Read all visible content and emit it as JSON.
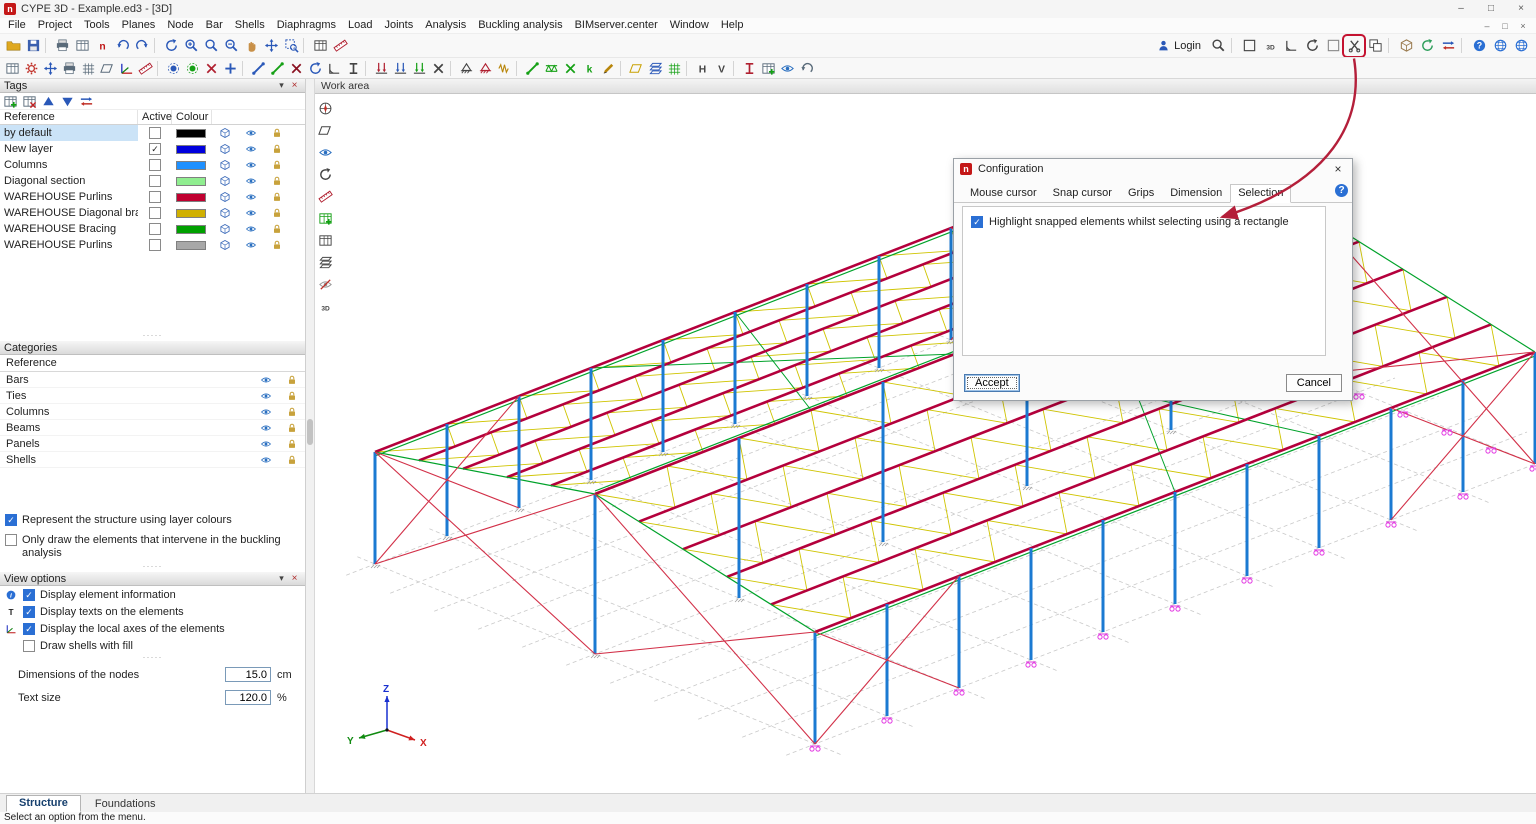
{
  "window": {
    "title": "CYPE 3D - Example.ed3 - [3D]"
  },
  "menu": {
    "items": [
      "File",
      "Project",
      "Tools",
      "Planes",
      "Node",
      "Bar",
      "Shells",
      "Diaphragms",
      "Load",
      "Joints",
      "Analysis",
      "Buckling analysis",
      "BIMserver.center",
      "Window",
      "Help"
    ]
  },
  "toolbar1": {
    "login_label": "Login",
    "left": [
      {
        "name": "open-file-icon",
        "t": "folder",
        "c": "#dfa81f"
      },
      {
        "name": "save-icon",
        "t": "disk",
        "c": "#3a5fae"
      },
      {
        "name": "sep"
      },
      {
        "name": "print-icon",
        "t": "printer",
        "c": "#5a6b7a"
      },
      {
        "name": "report-icon",
        "t": "table",
        "c": "#5a6b7a"
      },
      {
        "name": "cype-update-icon",
        "t": "letter",
        "c": "#c01818",
        "ch": "n"
      },
      {
        "name": "undo-icon",
        "t": "undo",
        "c": "#2a58b8"
      },
      {
        "name": "redo-icon",
        "t": "redo",
        "c": "#2a58b8"
      },
      {
        "name": "sep"
      },
      {
        "name": "redraw-icon",
        "t": "refresh",
        "c": "#2a58b8"
      },
      {
        "name": "zoom-in-icon",
        "t": "magplus",
        "c": "#2a58b8"
      },
      {
        "name": "zoom-previous-icon",
        "t": "mag",
        "c": "#2a58b8"
      },
      {
        "name": "zoom-out-icon",
        "t": "magminus",
        "c": "#2a58b8"
      },
      {
        "name": "pan-icon",
        "t": "hand",
        "c": "#c89048"
      },
      {
        "name": "orbit-icon",
        "t": "arrows",
        "c": "#2a58b8"
      },
      {
        "name": "zoom-window-icon",
        "t": "framemag",
        "c": "#2a58b8"
      },
      {
        "name": "sep"
      },
      {
        "name": "coordinates-icon",
        "t": "table",
        "c": "#444444"
      },
      {
        "name": "measure-icon",
        "t": "ruler",
        "c": "#b02030"
      }
    ],
    "right": [
      {
        "name": "search-icon",
        "t": "mag",
        "c": "#444444"
      },
      {
        "name": "sep"
      },
      {
        "name": "single-window-icon",
        "t": "frame",
        "c": "#444444"
      },
      {
        "name": "views-3d-icon",
        "t": "letter",
        "c": "#444444",
        "ch": "3D"
      },
      {
        "name": "angle-icon",
        "t": "angle",
        "c": "#444444"
      },
      {
        "name": "rotate-view-icon",
        "t": "refresh",
        "c": "#444444"
      },
      {
        "name": "drawing-sheet-icon",
        "t": "frame",
        "c": "#8a8a8a"
      },
      {
        "name": "selection-config-icon",
        "t": "xtool",
        "c": "#444444",
        "highlight": true
      },
      {
        "name": "split-view-icon",
        "t": "frames",
        "c": "#444444"
      },
      {
        "name": "sep"
      },
      {
        "name": "bim-model-icon",
        "t": "cube",
        "c": "#9a7b4f"
      },
      {
        "name": "bim-sync-icon",
        "t": "refresh",
        "c": "#2e9e5b"
      },
      {
        "name": "bim-export-icon",
        "t": "xfer",
        "c": "#c03028"
      },
      {
        "name": "sep"
      },
      {
        "name": "help-icon",
        "t": "help",
        "c": "#2a6fd4"
      },
      {
        "name": "web-icon",
        "t": "globe",
        "c": "#2a6fd4"
      },
      {
        "name": "account-icon",
        "t": "globe",
        "c": "#2a6fd4"
      }
    ]
  },
  "toolbar2": {
    "items": [
      {
        "name": "job-data-icon",
        "t": "table",
        "c": "#5a6b7a"
      },
      {
        "name": "general-options-icon",
        "t": "gear",
        "c": "#c03028"
      },
      {
        "name": "move-view-icon",
        "t": "arrows",
        "c": "#2a58b8"
      },
      {
        "name": "print-drawing-icon",
        "t": "printer",
        "c": "#5a6b7a"
      },
      {
        "name": "grid-icon",
        "t": "grid",
        "c": "#5a6b7a"
      },
      {
        "name": "planes-icon",
        "t": "plane",
        "c": "#5a6b7a"
      },
      {
        "name": "reference-axes-icon",
        "t": "axes3",
        "c": "#2a58b8"
      },
      {
        "name": "dimension-icon",
        "t": "ruler",
        "c": "#b02030"
      },
      {
        "name": "sep"
      },
      {
        "name": "new-node-icon",
        "t": "node",
        "c": "#2a58b8"
      },
      {
        "name": "move-node-icon",
        "t": "node",
        "c": "#15a015"
      },
      {
        "name": "delete-node-icon",
        "t": "x",
        "c": "#b02030"
      },
      {
        "name": "link-nodes-icon",
        "t": "plus",
        "c": "#2a58b8"
      },
      {
        "name": "sep"
      },
      {
        "name": "new-bar-icon",
        "t": "bar",
        "c": "#2a58b8"
      },
      {
        "name": "divide-bar-icon",
        "t": "bar",
        "c": "#15a015"
      },
      {
        "name": "delete-bar-icon",
        "t": "x",
        "c": "#8a1020"
      },
      {
        "name": "rotate-section-icon",
        "t": "refresh",
        "c": "#2a58b8"
      },
      {
        "name": "align-section-icon",
        "t": "angle",
        "c": "#444444"
      },
      {
        "name": "describe-section-icon",
        "t": "ibeam",
        "c": "#444444"
      },
      {
        "name": "sep"
      },
      {
        "name": "point-load-icon",
        "t": "load",
        "c": "#b02030"
      },
      {
        "name": "line-load-icon",
        "t": "load",
        "c": "#2a58b8"
      },
      {
        "name": "surface-load-icon",
        "t": "load",
        "c": "#15a015"
      },
      {
        "name": "delete-load-icon",
        "t": "x",
        "c": "#444444"
      },
      {
        "name": "sep"
      },
      {
        "name": "external-fixity-icon",
        "t": "support",
        "c": "#444444"
      },
      {
        "name": "internal-fixity-icon",
        "t": "support",
        "c": "#b02030"
      },
      {
        "name": "springs-icon",
        "t": "zig",
        "c": "#b8860b"
      },
      {
        "name": "sep"
      },
      {
        "name": "new-tie-icon",
        "t": "bar",
        "c": "#15a015"
      },
      {
        "name": "truss-icon",
        "t": "truss",
        "c": "#15a015"
      },
      {
        "name": "bracing-icon",
        "t": "x",
        "c": "#15a015"
      },
      {
        "name": "buckling-coeff-icon",
        "t": "letter",
        "c": "#15a015",
        "ch": "k"
      },
      {
        "name": "edit-icon",
        "t": "pencil",
        "c": "#b8860b"
      },
      {
        "name": "sep"
      },
      {
        "name": "panels-icon",
        "t": "plane",
        "c": "#c8a000"
      },
      {
        "name": "shells-icon",
        "t": "layers",
        "c": "#2a58b8"
      },
      {
        "name": "mesh-icon",
        "t": "grid",
        "c": "#15a015"
      },
      {
        "name": "sep"
      },
      {
        "name": "hide-horizontal-icon",
        "t": "letter",
        "c": "#444444",
        "ch": "H"
      },
      {
        "name": "hide-vertical-icon",
        "t": "letter",
        "c": "#444444",
        "ch": "V"
      },
      {
        "name": "sep"
      },
      {
        "name": "sections-icon",
        "t": "ibeam",
        "c": "#b02030"
      },
      {
        "name": "tags-manager-icon",
        "t": "tableplus",
        "c": "#5a6b7a"
      },
      {
        "name": "visibility-icon",
        "t": "eye",
        "c": "#2a6fc0"
      },
      {
        "name": "undo-view-icon",
        "t": "undo",
        "c": "#5a6b7a"
      }
    ]
  },
  "tags": {
    "title": "Tags",
    "tools": [
      {
        "name": "add-layer-icon",
        "t": "tableplus",
        "c": "#5a6b7a"
      },
      {
        "name": "remove-layer-icon",
        "t": "tablex",
        "c": "#5a6b7a"
      },
      {
        "name": "move-layer-up-icon",
        "t": "triup",
        "c": "#2a58b8"
      },
      {
        "name": "move-layer-down-icon",
        "t": "tridown",
        "c": "#2a58b8"
      },
      {
        "name": "assign-layer-icon",
        "t": "xfer",
        "c": "#2a58b8"
      }
    ],
    "columns": [
      "Reference",
      "Active",
      "Colour"
    ],
    "rows": [
      {
        "reference": "by default",
        "active": false,
        "colour": "#000000"
      },
      {
        "reference": "New layer",
        "active": true,
        "colour": "#0000dd"
      },
      {
        "reference": "Columns",
        "active": false,
        "colour": "#1e90ff"
      },
      {
        "reference": "Diagonal section",
        "active": false,
        "colour": "#90ee90"
      },
      {
        "reference": "WAREHOUSE Purlins",
        "active": false,
        "colour": "#c00030"
      },
      {
        "reference": "WAREHOUSE Diagonal brac...",
        "active": false,
        "colour": "#d0b000"
      },
      {
        "reference": "WAREHOUSE Bracing",
        "active": false,
        "colour": "#00a000"
      },
      {
        "reference": "WAREHOUSE Purlins",
        "active": false,
        "colour": "#a8a8a8"
      }
    ]
  },
  "categories": {
    "title": "Categories",
    "header": "Reference",
    "items": [
      "Bars",
      "Ties",
      "Columns",
      "Beams",
      "Panels",
      "Shells"
    ]
  },
  "options": {
    "represent_label": "Represent the structure using layer colours",
    "represent_checked": true,
    "buckling_label": "Only draw the elements that intervene in the buckling analysis",
    "buckling_checked": false
  },
  "view_options": {
    "title": "View options",
    "rows": [
      {
        "label": "Display element information",
        "checked": true,
        "icon": "info",
        "c": "#2a6fd4"
      },
      {
        "label": "Display texts on the elements",
        "checked": true,
        "icon": "letter",
        "ch": "T",
        "c": "#222222"
      },
      {
        "label": "Display the local axes of the elements",
        "checked": true,
        "icon": "axes3",
        "c": "#444444"
      },
      {
        "label": "Draw shells with fill",
        "checked": false,
        "icon": null
      }
    ],
    "node_size_label": "Dimensions of the nodes",
    "node_size_value": "15.0",
    "node_size_unit": "cm",
    "text_size_label": "Text size",
    "text_size_value": "120.0",
    "text_size_unit": "%"
  },
  "work_area": {
    "title": "Work area",
    "tools": [
      {
        "name": "coordinate-system-icon",
        "t": "compass",
        "c": "#444444"
      },
      {
        "name": "work-plane-icon",
        "t": "plane",
        "c": "#444444"
      },
      {
        "name": "visibility-icon",
        "t": "eye",
        "c": "#2a6fc0"
      },
      {
        "name": "orbit-view-icon",
        "t": "refresh",
        "c": "#444444"
      },
      {
        "name": "measure-icon",
        "t": "ruler",
        "c": "#b02030"
      },
      {
        "name": "selection-list-icon",
        "t": "tableplus",
        "c": "#15a015"
      },
      {
        "name": "data-table-icon",
        "t": "table",
        "c": "#444444"
      },
      {
        "name": "layers-icon",
        "t": "layers",
        "c": "#444444"
      },
      {
        "name": "hide-elements-icon",
        "t": "eyeoff",
        "c": "#888888"
      },
      {
        "name": "view-3d-icon",
        "t": "letter",
        "c": "#444444",
        "ch": "3D"
      }
    ]
  },
  "scene": {
    "colors": {
      "column": "#1b7ad2",
      "purlin": "#b4003c",
      "web": "#cfc400",
      "outline": "#00a22a",
      "grid": "#c9c9c9",
      "support": "#e23ae2",
      "brace": "#d23048"
    },
    "axes": {
      "x": "X",
      "y": "Y",
      "z": "Z",
      "x_color": "#d02020",
      "y_color": "#108a10",
      "z_color": "#1830d0"
    }
  },
  "dialog": {
    "title": "Configuration",
    "tabs": [
      "Mouse cursor",
      "Snap cursor",
      "Grips",
      "Dimension",
      "Selection"
    ],
    "active_tab": "Selection",
    "checkbox_label": "Highlight snapped elements whilst selecting using a rectangle",
    "checkbox_checked": true,
    "accept_label": "Accept",
    "cancel_label": "Cancel"
  },
  "bottom": {
    "tabs": [
      {
        "label": "Structure",
        "active": true
      },
      {
        "label": "Foundations",
        "active": false
      }
    ],
    "status": "Select an option from the menu."
  }
}
